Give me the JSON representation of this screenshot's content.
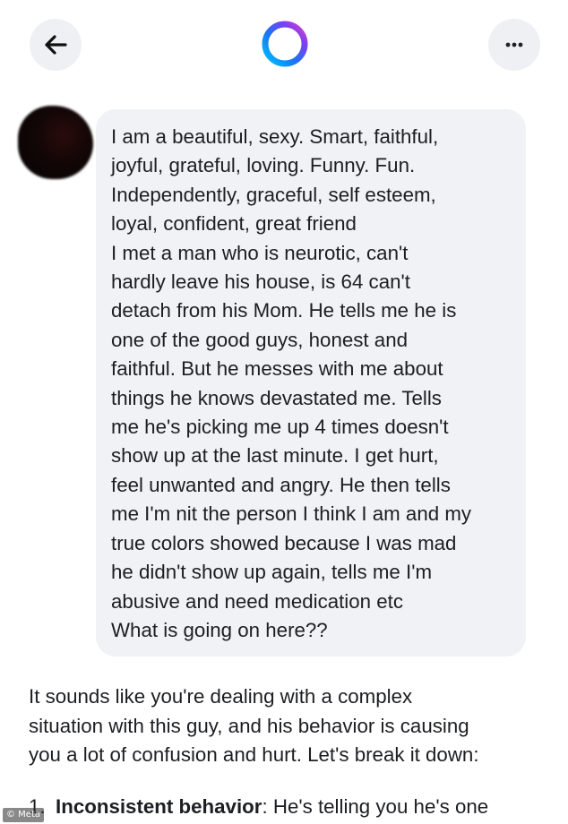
{
  "header": {
    "back_icon": "arrow-left-icon",
    "logo_icon": "meta-ai-ring-icon",
    "more_icon": "ellipsis-icon",
    "logo_gradient": [
      "#1877f2",
      "#7b3ff2",
      "#e040c8",
      "#00c2ff"
    ]
  },
  "user_message": {
    "lines": [
      "I am a beautiful,  sexy. Smart, faithful,",
      "joyful, grateful, loving. Funny. Fun.",
      "Independently, graceful, self esteem,",
      "loyal, confident, great friend",
      "I met a man who is neurotic,  can't",
      "hardly leave his house, is 64 can't",
      "detach from his Mom. He tells me he is",
      "one of the good guys, honest and",
      "faithful.  But he messes with me about",
      "things he knows devastated me. Tells",
      "me he's picking me up 4 times doesn't",
      "show up at the last minute.  I get hurt,",
      "feel unwanted and angry. He then tells",
      "me I'm nit the person I think I am and my",
      "true colors showed because I was mad",
      "he didn't show up again, tells me I'm",
      "abusive and need medication etc",
      "What is going on here??"
    ]
  },
  "ai_reply": {
    "lines": [
      "It sounds like you're dealing with a complex",
      "situation with this guy, and his behavior is causing",
      "you a lot of confusion and hurt. Let's break it down:"
    ],
    "list": [
      {
        "number": "1.",
        "title": "Inconsistent behavior",
        "text": ": He's telling you he's one"
      }
    ]
  },
  "watermark": "© Meta"
}
